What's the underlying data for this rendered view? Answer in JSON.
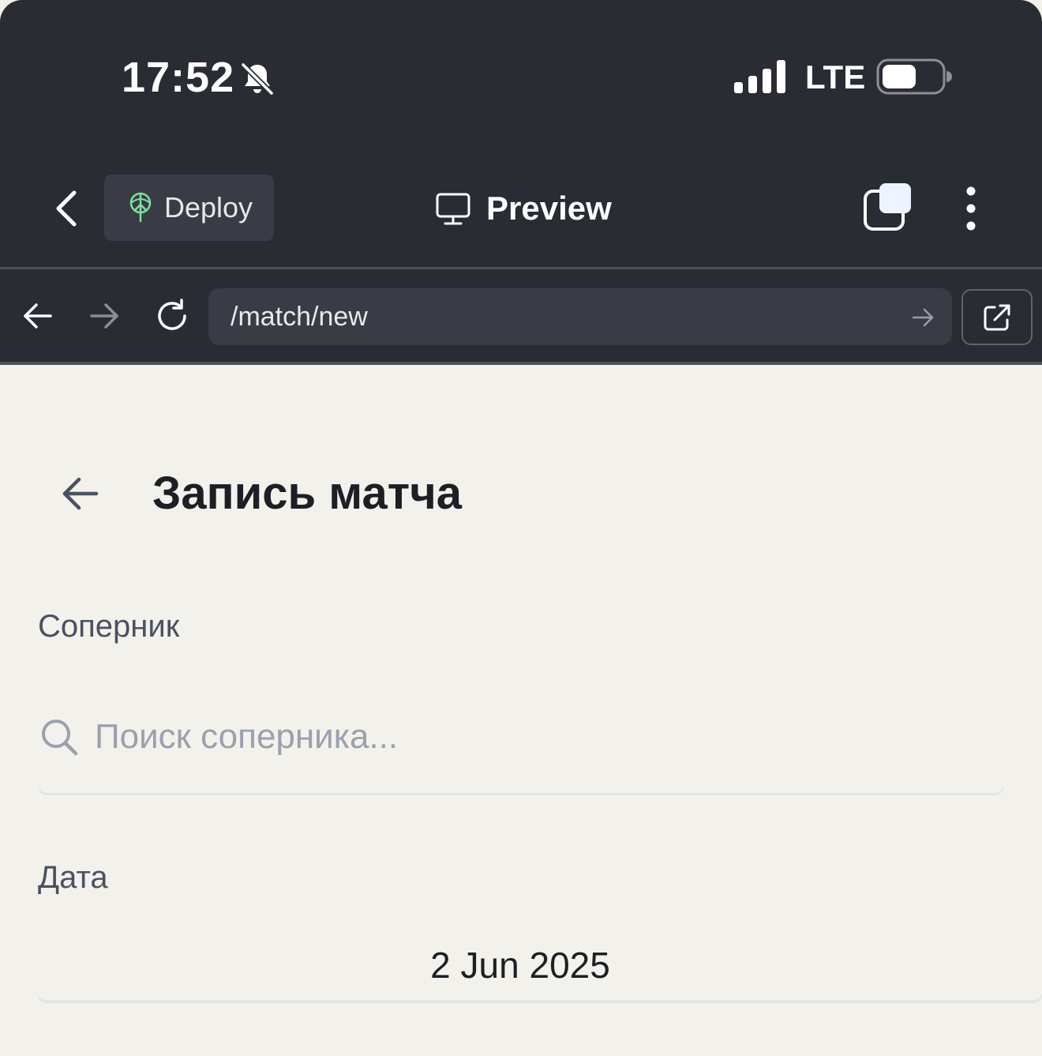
{
  "status_bar": {
    "time": "17:52",
    "network": "LTE",
    "icons": [
      "bell-muted-icon",
      "signal-icon",
      "battery-icon"
    ]
  },
  "toolbar": {
    "deploy_label": "Deploy",
    "preview_label": "Preview",
    "icons": [
      "chevron-left-icon",
      "deploy-icon",
      "monitor-icon",
      "tabs-icon",
      "more-vertical-icon"
    ]
  },
  "browser": {
    "url": "/match/new",
    "icons": [
      "arrow-left-icon",
      "arrow-right-icon",
      "reload-icon",
      "go-arrow-icon",
      "external-link-icon"
    ]
  },
  "page": {
    "title": "Запись матча",
    "opponent_label": "Соперник",
    "search_placeholder": "Поиск соперника...",
    "date_label": "Дата",
    "date_value": "2 Jun 2025"
  },
  "colors": {
    "chrome_bg": "#292c33",
    "page_bg": "#f3f1eb",
    "deploy_accent": "#7ee0a0",
    "text_dark": "#1d1f24",
    "label_gray": "#4a5160"
  }
}
